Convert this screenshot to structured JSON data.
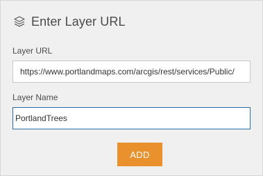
{
  "header": {
    "icon": "layers-icon",
    "title": "Enter Layer URL"
  },
  "form": {
    "url_label": "Layer URL",
    "url_value": "https://www.portlandmaps.com/arcgis/rest/services/Public/",
    "name_label": "Layer Name",
    "name_value": "PortlandTrees",
    "add_label": "ADD"
  },
  "colors": {
    "panel_background": "#f0f0f0",
    "accent_button": "#e8912d",
    "focus_border": "#2b6ea6"
  }
}
